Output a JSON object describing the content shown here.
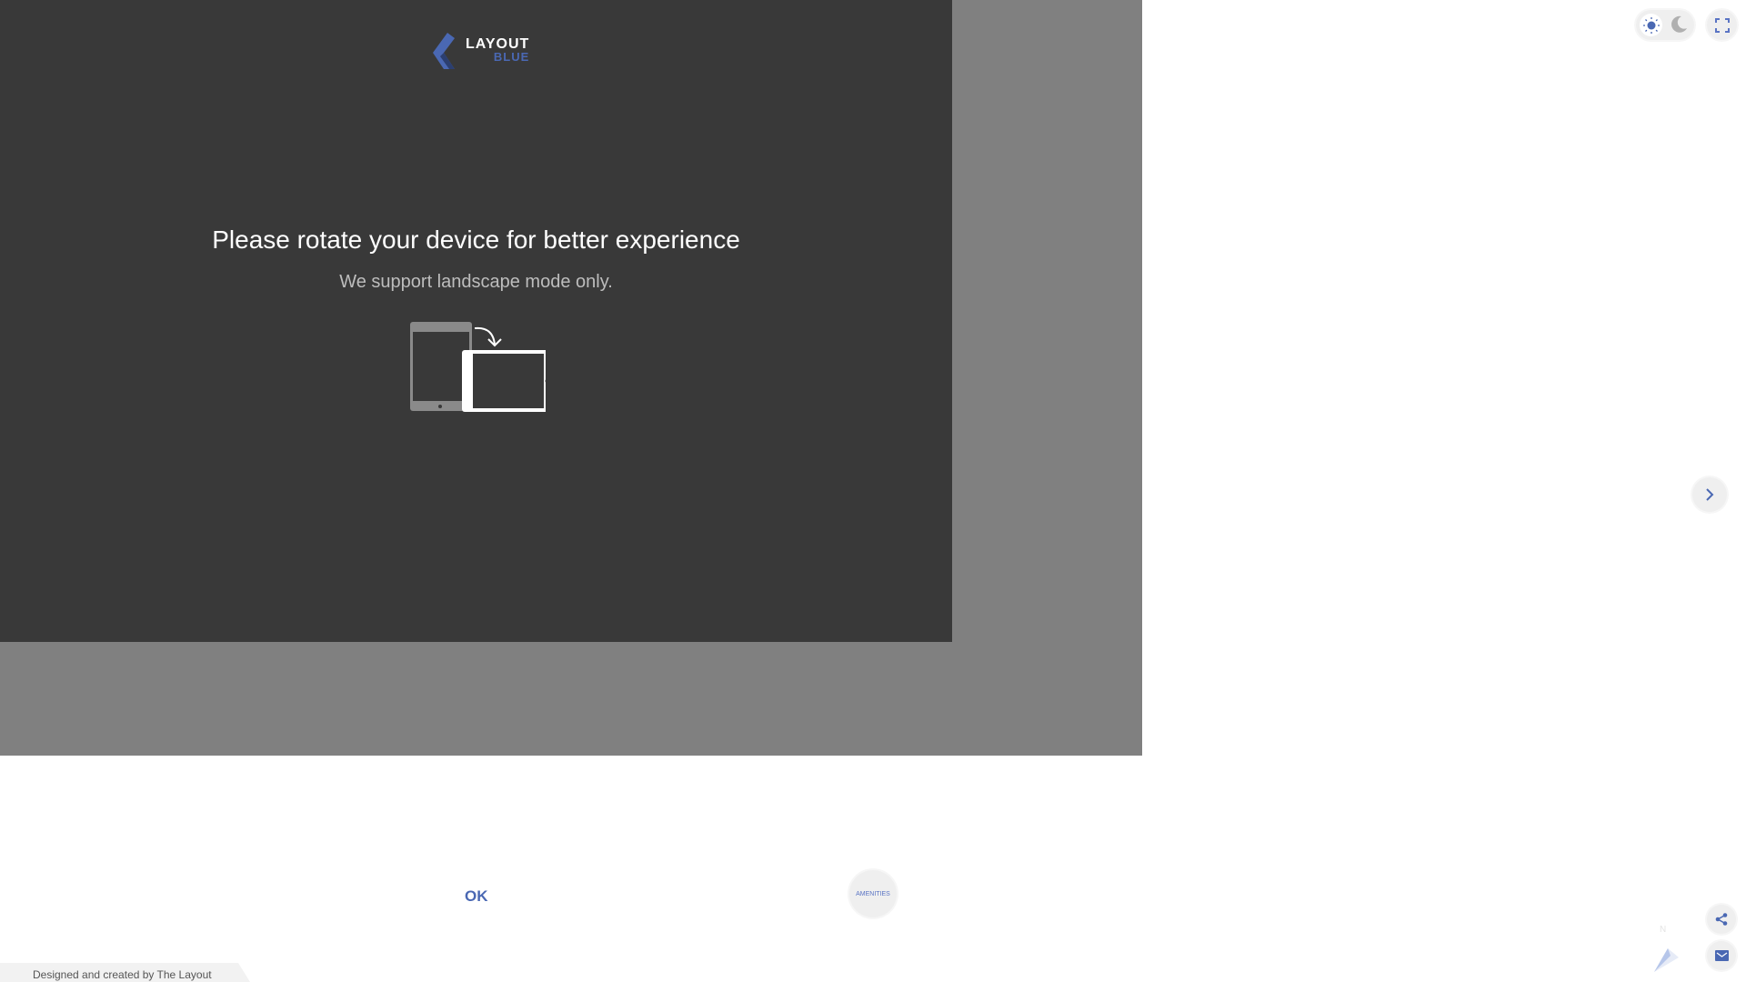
{
  "logo": {
    "line1": "LAYOUT",
    "line2": "BLUE"
  },
  "message": {
    "title": "Please rotate your device for better experience",
    "subtitle": "We support landscape mode only."
  },
  "ok_label": "OK",
  "amenities_label": "AMENITIES",
  "compass_label": "N",
  "footer": "Designed and created by The Layout",
  "colors": {
    "accent": "#4a68b3",
    "panel": "#393939",
    "overlay": "#808080"
  }
}
